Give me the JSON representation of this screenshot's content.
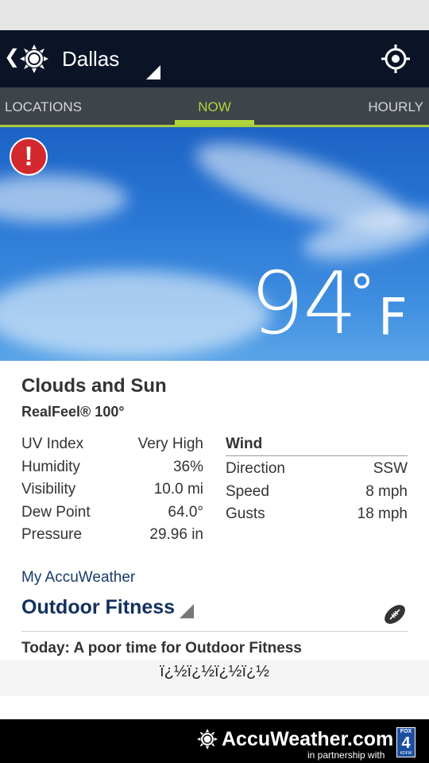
{
  "app_bar": {
    "back_icon": "chevron-left",
    "app_icon": "sun-icon",
    "city": "Dallas",
    "locate_icon": "crosshair-icon"
  },
  "tabs": [
    {
      "label": "LOCATIONS",
      "active": false
    },
    {
      "label": "NOW",
      "active": true
    },
    {
      "label": "HOURLY",
      "active": false
    }
  ],
  "hero": {
    "alert_icon": "exclamation-icon",
    "alert_glyph": "!",
    "temperature": "94",
    "degree": "°",
    "unit": "F"
  },
  "current": {
    "condition": "Clouds and Sun",
    "realfeel_label": "RealFeel® 100°"
  },
  "stats": [
    {
      "label": "UV Index",
      "value": "Very High"
    },
    {
      "label": "Humidity",
      "value": "36%"
    },
    {
      "label": "Visibility",
      "value": "10.0 mi"
    },
    {
      "label": "Dew Point",
      "value": "64.0°"
    },
    {
      "label": "Pressure",
      "value": "29.96 in"
    }
  ],
  "wind": {
    "title": "Wind",
    "rows": [
      {
        "label": "Direction",
        "value": "SSW"
      },
      {
        "label": "Speed",
        "value": "8 mph"
      },
      {
        "label": "Gusts",
        "value": "18 mph"
      }
    ]
  },
  "my_accuweather": {
    "heading": "My AccuWeather",
    "activity": "Outdoor Fitness",
    "activity_icon": "football-icon",
    "forecast": "Today: A poor time for Outdoor Fitness",
    "garbled_text": "ï¿½ï¿½ï¿½ï¿½"
  },
  "footer": {
    "brand": "AccuWeather.com",
    "partner": "in partnership with",
    "station_top": "FOX",
    "station_num": "4",
    "station_bottom": "KDFW"
  },
  "colors": {
    "appbar": "#0b1426",
    "tab_bar": "#3e4449",
    "accent": "#b4d43d",
    "sky": "#2a78d6",
    "alert": "#d2282e",
    "heading_blue": "#12305f"
  }
}
